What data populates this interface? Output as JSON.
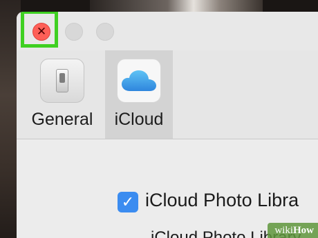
{
  "window": {
    "traffic_lights": {
      "close_glyph": "✕",
      "close_color": "#fe5f57",
      "highlight_color": "#3fd022"
    }
  },
  "toolbar": {
    "tabs": [
      {
        "label": "General",
        "icon": "light-switch-icon",
        "selected": false
      },
      {
        "label": "iCloud",
        "icon": "cloud-icon",
        "selected": true
      }
    ]
  },
  "content": {
    "photo_library_checkbox": {
      "checked": true,
      "label": "iCloud Photo Libra"
    },
    "sub_label": "iCloud Photo Library"
  },
  "watermark": {
    "prefix": "wiki",
    "suffix": "How"
  },
  "colors": {
    "accent": "#3b8cf0"
  }
}
